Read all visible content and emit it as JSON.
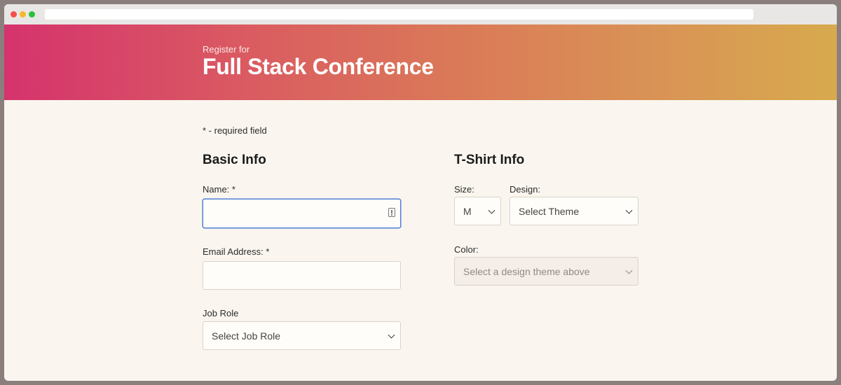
{
  "hero": {
    "subtitle": "Register for",
    "title": "Full Stack Conference"
  },
  "form": {
    "required_note": "* - required field",
    "basic_info": {
      "title": "Basic Info",
      "name_label": "Name: *",
      "name_value": "",
      "email_label": "Email Address: *",
      "email_value": "",
      "job_role_label": "Job Role",
      "job_role_selected": "Select Job Role"
    },
    "tshirt_info": {
      "title": "T-Shirt Info",
      "size_label": "Size:",
      "size_selected": "M",
      "design_label": "Design:",
      "design_selected": "Select Theme",
      "color_label": "Color:",
      "color_selected": "Select a design theme above"
    }
  },
  "colors": {
    "gradient_start": "#d5336d",
    "gradient_end": "#d7aa4d",
    "focus_border": "#4d7fd6",
    "page_background": "#faf6ef"
  }
}
